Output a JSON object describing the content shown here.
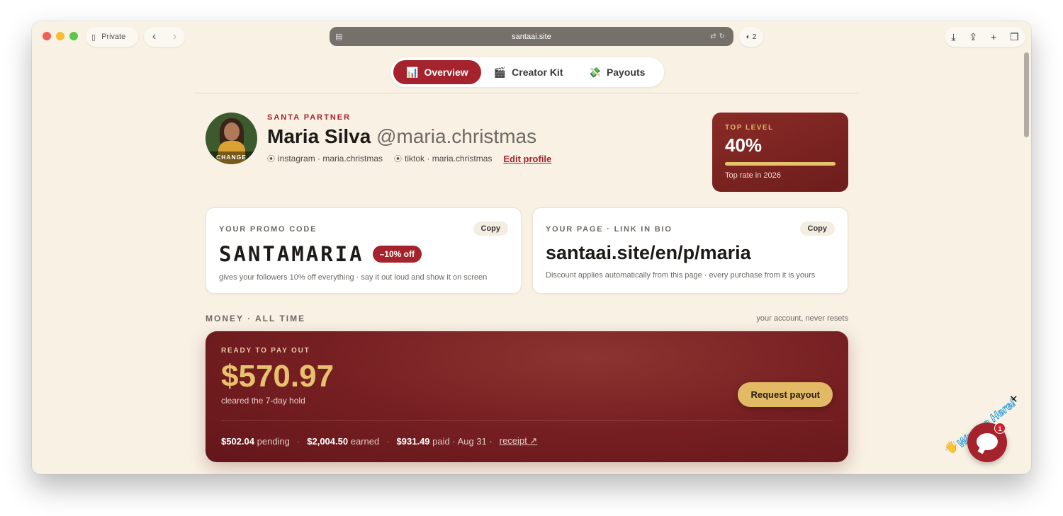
{
  "browser": {
    "private_label": "Private",
    "url": "santaai.site",
    "extension_count": "2"
  },
  "tabs": [
    {
      "icon": "📊",
      "label": "Overview",
      "active": true
    },
    {
      "icon": "🎬",
      "label": "Creator Kit",
      "active": false
    },
    {
      "icon": "💸",
      "label": "Payouts",
      "active": false
    }
  ],
  "profile": {
    "avatar_action": "CHANGE",
    "eyebrow": "SANTA PARTNER",
    "name": "Maria Silva",
    "handle": "@maria.christmas",
    "socials": [
      {
        "text": "instagram · maria.christmas"
      },
      {
        "text": "tiktok · maria.christmas"
      }
    ],
    "edit_label": "Edit profile"
  },
  "level": {
    "label": "TOP LEVEL",
    "percent": "40%",
    "progress": 1.0,
    "note": "Top rate in 2026"
  },
  "promo": {
    "label": "YOUR PROMO CODE",
    "copy_label": "Copy",
    "code": "SANTAMARIA",
    "badge": "–10% off",
    "desc": "gives your followers 10% off everything · say it out loud and show it on screen"
  },
  "page_link": {
    "label": "YOUR PAGE · LINK IN BIO",
    "copy_label": "Copy",
    "url": "santaai.site/en/p/maria",
    "desc": "Discount applies automatically from this page · every purchase from it is yours"
  },
  "money": {
    "section_title": "MONEY · ALL TIME",
    "section_note": "your account, never resets",
    "ready_label": "READY TO PAY OUT",
    "amount": "$570.97",
    "sub": "cleared the 7-day hold",
    "request_label": "Request payout",
    "pending_value": "$502.04",
    "pending_label": "pending",
    "earned_value": "$2,004.50",
    "earned_label": "earned",
    "paid_value": "$931.49",
    "paid_label": "paid · Aug 31 ·",
    "receipt_label": "receipt ↗"
  },
  "chat": {
    "text": "We Are Here!",
    "badge": "1",
    "close": "✕"
  }
}
